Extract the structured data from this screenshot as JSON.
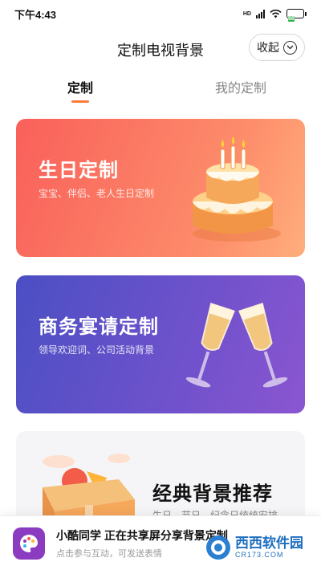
{
  "status": {
    "time": "下午4:43",
    "hd": "HD",
    "battery": "88"
  },
  "header": {
    "title": "定制电视背景",
    "collapse_label": "收起"
  },
  "tabs": [
    {
      "label": "定制",
      "active": true
    },
    {
      "label": "我的定制",
      "active": false
    }
  ],
  "cards": [
    {
      "title": "生日定制",
      "subtitle": "宝宝、伴侣、老人生日定制",
      "icon": "birthday-cake-icon"
    },
    {
      "title": "商务宴请定制",
      "subtitle": "领导欢迎词、公司活动背景",
      "icon": "champagne-glasses-icon"
    },
    {
      "title": "经典背景推荐",
      "subtitle": "生日、节日、纪念日统统安排",
      "icon": "gift-box-icon"
    }
  ],
  "notice": {
    "title": "小酷同学 正在共享屏分享背景定制",
    "subtitle": "点击参与互动，可发送表情"
  },
  "watermark": {
    "name": "西西软件园",
    "url": "CR173.COM"
  },
  "colors": {
    "accent": "#ff7a3c",
    "birthday": "#f9605a",
    "business": "#5b50c8"
  }
}
